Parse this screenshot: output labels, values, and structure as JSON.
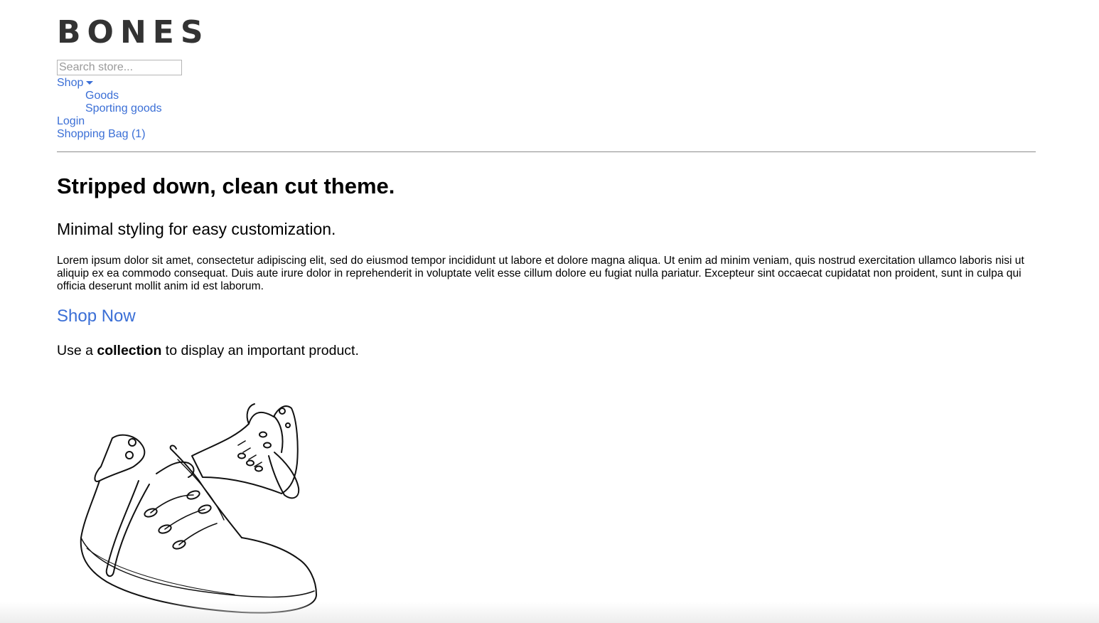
{
  "header": {
    "logo": "BONES",
    "search": {
      "placeholder": "Search store..."
    },
    "nav": {
      "shop_label": "Shop",
      "shop_items": [
        "Goods",
        "Sporting goods"
      ],
      "login_label": "Login",
      "bag_label": "Shopping Bag (1)"
    }
  },
  "main": {
    "heading": "Stripped down, clean cut theme.",
    "subheading": "Minimal styling for easy customization.",
    "body": "Lorem ipsum dolor sit amet, consectetur adipiscing elit, sed do eiusmod tempor incididunt ut labore et dolore magna aliqua. Ut enim ad minim veniam, quis nostrud exercitation ullamco laboris nisi ut aliquip ex ea commodo consequat. Duis aute irure dolor in reprehenderit in voluptate velit esse cillum dolore eu fugiat nulla pariatur. Excepteur sint occaecat cupidatat non proident, sunt in culpa qui officia deserunt mollit anim id est laborum.",
    "cta_label": "Shop Now",
    "collection_note": {
      "before": "Use a ",
      "bold": "collection",
      "after": " to display an important product."
    }
  },
  "colors": {
    "link": "#3b6fd6",
    "logo": "#333333",
    "rule": "#8c8c8c"
  },
  "icons": {
    "shop_dropdown": "caret-down-icon",
    "hero_image": "sneakers-illustration"
  }
}
